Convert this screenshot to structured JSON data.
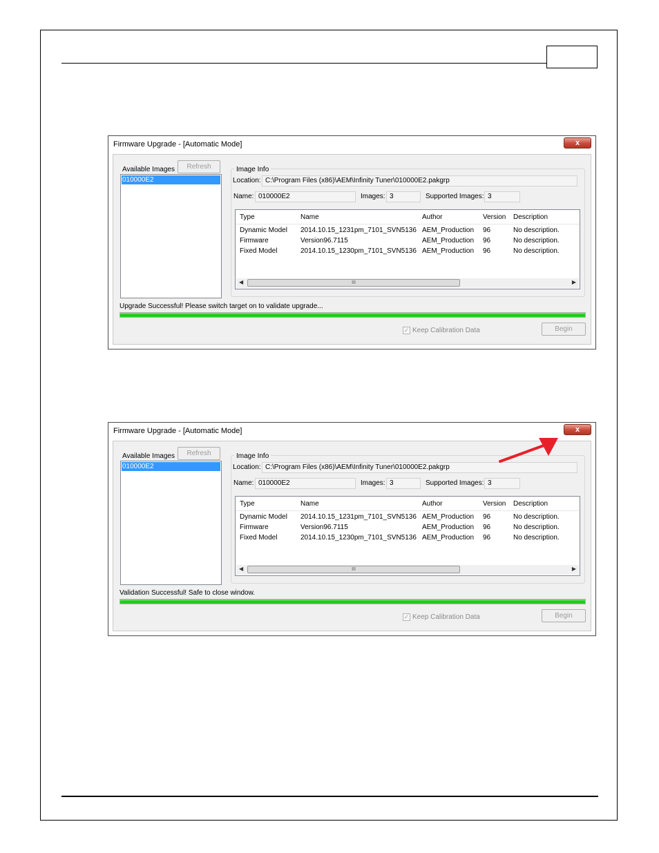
{
  "dialogs": [
    {
      "title": "Firmware Upgrade - [Automatic Mode]",
      "close_label": "x",
      "available_images_label": "Available Images",
      "refresh_label": "Refresh",
      "images": [
        "010000E2"
      ],
      "image_info_label": "Image Info",
      "location_label": "Location:",
      "location_value": "C:\\Program Files (x86)\\AEM\\Infinity Tuner\\010000E2.pakgrp",
      "name_label": "Name:",
      "name_value": "010000E2",
      "images_label": "Images:",
      "images_value": "3",
      "supported_label": "Supported Images:",
      "supported_value": "3",
      "columns": [
        "Type",
        "Name",
        "Author",
        "Version",
        "Description"
      ],
      "rows": [
        [
          "Dynamic Model",
          "2014.10.15_1231pm_7101_SVN5136",
          "AEM_Production",
          "96",
          "No description."
        ],
        [
          "Firmware",
          "Version96.7115",
          "AEM_Production",
          "96",
          "No description."
        ],
        [
          "Fixed Model",
          "2014.10.15_1230pm_7101_SVN5136",
          "AEM_Production",
          "96",
          "No description."
        ]
      ],
      "scroll_grip": "III",
      "status": "Upgrade Successful!  Please switch target on to validate upgrade...",
      "progress": 1.0,
      "keep_calibration_label": "Keep Calibration Data",
      "keep_calibration_checked": true,
      "begin_label": "Begin"
    },
    {
      "title": "Firmware Upgrade - [Automatic Mode]",
      "close_label": "x",
      "available_images_label": "Available Images",
      "refresh_label": "Refresh",
      "images": [
        "010000E2"
      ],
      "image_info_label": "Image Info",
      "location_label": "Location:",
      "location_value": "C:\\Program Files (x86)\\AEM\\Infinity Tuner\\010000E2.pakgrp",
      "name_label": "Name:",
      "name_value": "010000E2",
      "images_label": "Images:",
      "images_value": "3",
      "supported_label": "Supported Images:",
      "supported_value": "3",
      "columns": [
        "Type",
        "Name",
        "Author",
        "Version",
        "Description"
      ],
      "rows": [
        [
          "Dynamic Model",
          "2014.10.15_1231pm_7101_SVN5136",
          "AEM_Production",
          "96",
          "No description."
        ],
        [
          "Firmware",
          "Version96.7115",
          "AEM_Production",
          "96",
          "No description."
        ],
        [
          "Fixed Model",
          "2014.10.15_1230pm_7101_SVN5136",
          "AEM_Production",
          "96",
          "No description."
        ]
      ],
      "scroll_grip": "III",
      "status": "Validation Successful!  Safe to close window.",
      "progress": 1.0,
      "keep_calibration_label": "Keep Calibration Data",
      "keep_calibration_checked": true,
      "begin_label": "Begin"
    }
  ],
  "annotation": {
    "arrow_color": "#e8202a",
    "points_to": "close-button"
  },
  "colors": {
    "selection": "#3399ff",
    "progress": "#12c612",
    "close_button": "#c8493a"
  }
}
